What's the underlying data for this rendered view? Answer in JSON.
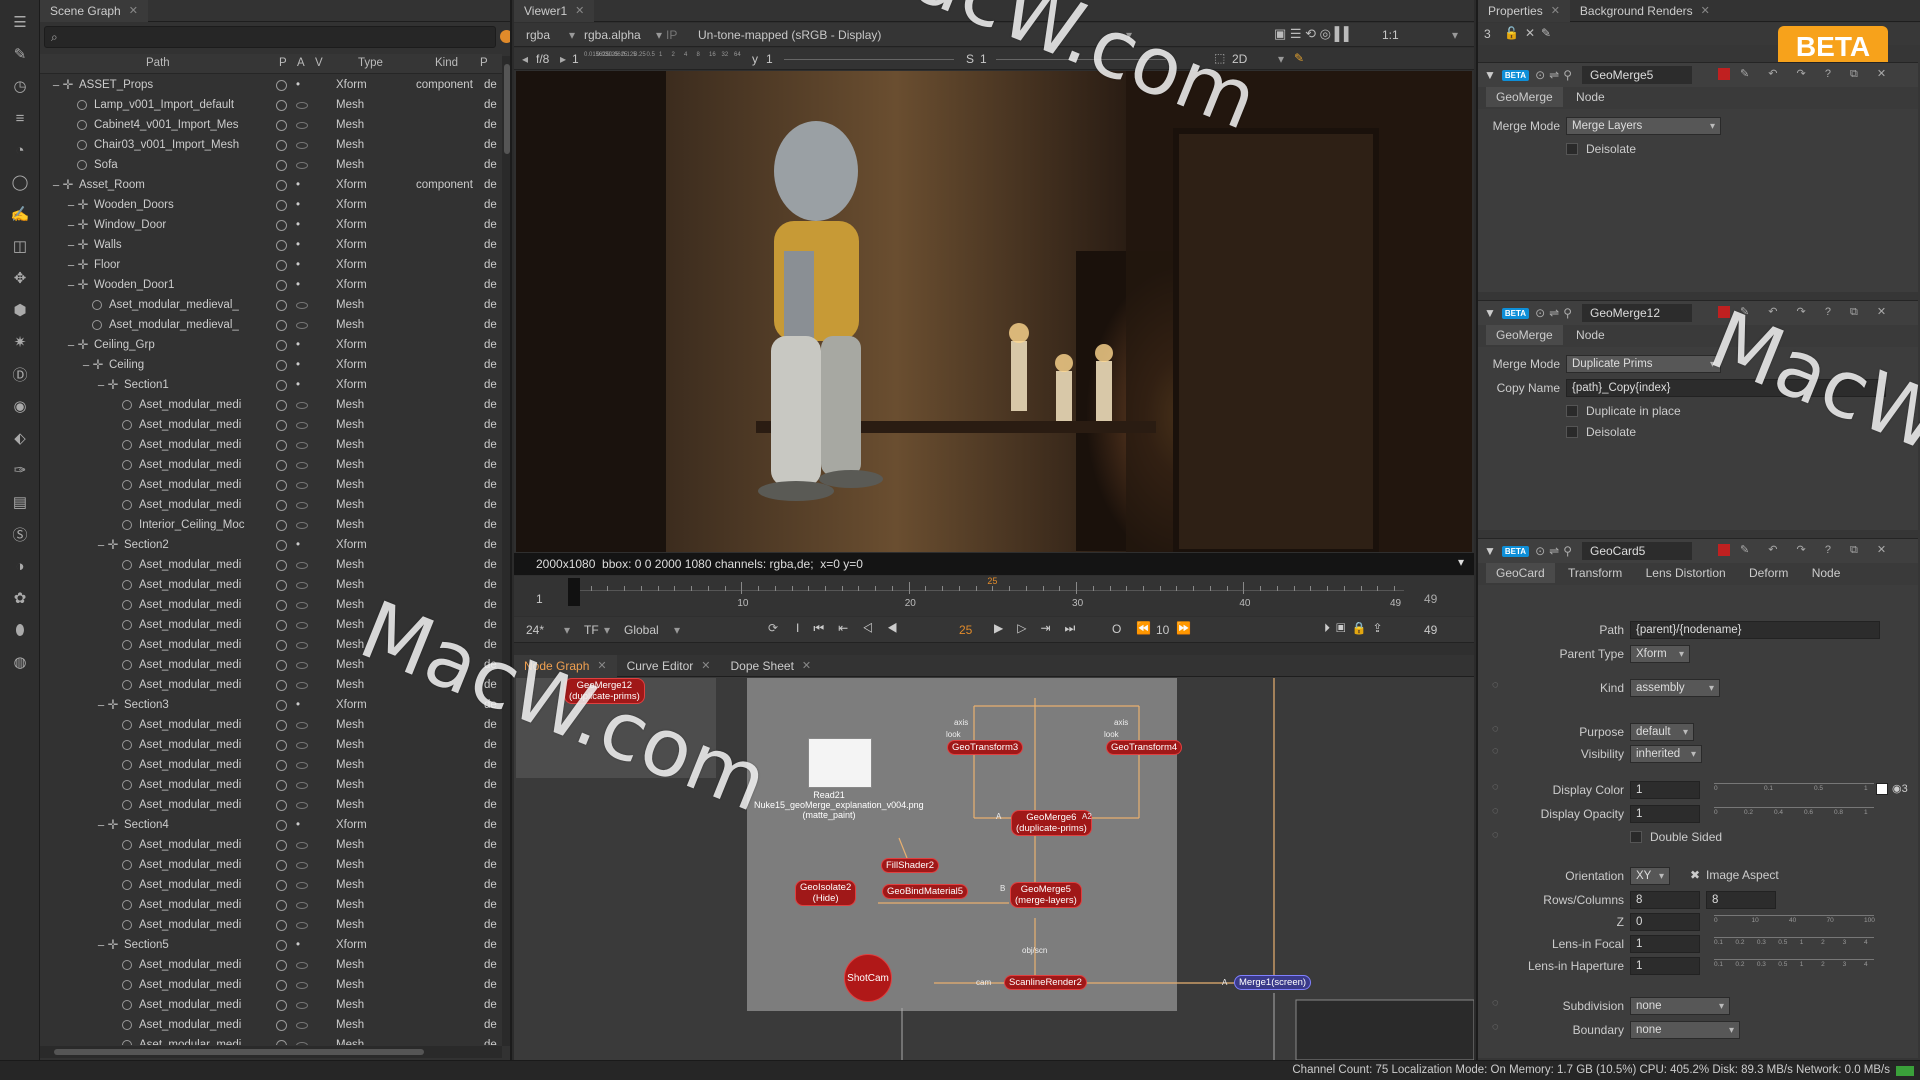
{
  "left_toolbar": {
    "icons": [
      "layers-icon",
      "pen-icon",
      "clock-icon",
      "list-icon",
      "pie-icon",
      "circle-icon",
      "paint-icon",
      "stack-icon",
      "move-icon",
      "cube-icon",
      "sparkle-icon",
      "d-icon",
      "eye-icon",
      "tag-icon",
      "brush-icon",
      "film-icon",
      "scene-icon",
      "wave-icon",
      "flower-icon",
      "cylinder-icon",
      "sphere-icon"
    ]
  },
  "scene_graph": {
    "tab": "Scene Graph",
    "headers": {
      "path": "Path",
      "p": "P",
      "a": "A",
      "v": "V",
      "type": "Type",
      "kind": "Kind",
      "p2": "P"
    },
    "rows": [
      {
        "indent": 1,
        "icon": "x",
        "name": "ASSET_Props",
        "type": "Xform",
        "kind": "component",
        "d": "de"
      },
      {
        "indent": 2,
        "icon": "m",
        "name": "Lamp_v001_Import_default",
        "type": "Mesh",
        "kind": "",
        "d": "de"
      },
      {
        "indent": 2,
        "icon": "m",
        "name": "Cabinet4_v001_Import_Mes",
        "type": "Mesh",
        "kind": "",
        "d": "de"
      },
      {
        "indent": 2,
        "icon": "m",
        "name": "Chair03_v001_Import_Mesh",
        "type": "Mesh",
        "kind": "",
        "d": "de"
      },
      {
        "indent": 2,
        "icon": "m",
        "name": "Sofa",
        "type": "Mesh",
        "kind": "",
        "d": "de"
      },
      {
        "indent": 1,
        "icon": "x",
        "name": "Asset_Room",
        "type": "Xform",
        "kind": "component",
        "d": "de"
      },
      {
        "indent": 2,
        "icon": "x",
        "name": "Wooden_Doors",
        "type": "Xform",
        "kind": "",
        "d": "de"
      },
      {
        "indent": 2,
        "icon": "x",
        "name": "Window_Door",
        "type": "Xform",
        "kind": "",
        "d": "de"
      },
      {
        "indent": 2,
        "icon": "x",
        "name": "Walls",
        "type": "Xform",
        "kind": "",
        "d": "de"
      },
      {
        "indent": 2,
        "icon": "x",
        "name": "Floor",
        "type": "Xform",
        "kind": "",
        "d": "de"
      },
      {
        "indent": 2,
        "icon": "x",
        "name": "Wooden_Door1",
        "type": "Xform",
        "kind": "",
        "d": "de"
      },
      {
        "indent": 3,
        "icon": "m",
        "name": "Aset_modular_medieval_",
        "type": "Mesh",
        "kind": "",
        "d": "de"
      },
      {
        "indent": 3,
        "icon": "m",
        "name": "Aset_modular_medieval_",
        "type": "Mesh",
        "kind": "",
        "d": "de"
      },
      {
        "indent": 2,
        "icon": "x",
        "name": "Ceiling_Grp",
        "type": "Xform",
        "kind": "",
        "d": "de"
      },
      {
        "indent": 3,
        "icon": "x",
        "name": "Ceiling",
        "type": "Xform",
        "kind": "",
        "d": "de"
      },
      {
        "indent": 4,
        "icon": "x",
        "name": "Section1",
        "type": "Xform",
        "kind": "",
        "d": "de"
      },
      {
        "indent": 5,
        "icon": "m",
        "name": "Aset_modular_medi",
        "type": "Mesh",
        "kind": "",
        "d": "de"
      },
      {
        "indent": 5,
        "icon": "m",
        "name": "Aset_modular_medi",
        "type": "Mesh",
        "kind": "",
        "d": "de"
      },
      {
        "indent": 5,
        "icon": "m",
        "name": "Aset_modular_medi",
        "type": "Mesh",
        "kind": "",
        "d": "de"
      },
      {
        "indent": 5,
        "icon": "m",
        "name": "Aset_modular_medi",
        "type": "Mesh",
        "kind": "",
        "d": "de"
      },
      {
        "indent": 5,
        "icon": "m",
        "name": "Aset_modular_medi",
        "type": "Mesh",
        "kind": "",
        "d": "de"
      },
      {
        "indent": 5,
        "icon": "m",
        "name": "Aset_modular_medi",
        "type": "Mesh",
        "kind": "",
        "d": "de"
      },
      {
        "indent": 5,
        "icon": "m",
        "name": "Interior_Ceiling_Moc",
        "type": "Mesh",
        "kind": "",
        "d": "de"
      },
      {
        "indent": 4,
        "icon": "x",
        "name": "Section2",
        "type": "Xform",
        "kind": "",
        "d": "de"
      },
      {
        "indent": 5,
        "icon": "m",
        "name": "Aset_modular_medi",
        "type": "Mesh",
        "kind": "",
        "d": "de"
      },
      {
        "indent": 5,
        "icon": "m",
        "name": "Aset_modular_medi",
        "type": "Mesh",
        "kind": "",
        "d": "de"
      },
      {
        "indent": 5,
        "icon": "m",
        "name": "Aset_modular_medi",
        "type": "Mesh",
        "kind": "",
        "d": "de"
      },
      {
        "indent": 5,
        "icon": "m",
        "name": "Aset_modular_medi",
        "type": "Mesh",
        "kind": "",
        "d": "de"
      },
      {
        "indent": 5,
        "icon": "m",
        "name": "Aset_modular_medi",
        "type": "Mesh",
        "kind": "",
        "d": "de"
      },
      {
        "indent": 5,
        "icon": "m",
        "name": "Aset_modular_medi",
        "type": "Mesh",
        "kind": "",
        "d": "de"
      },
      {
        "indent": 5,
        "icon": "m",
        "name": "Aset_modular_medi",
        "type": "Mesh",
        "kind": "",
        "d": "de"
      },
      {
        "indent": 4,
        "icon": "x",
        "name": "Section3",
        "type": "Xform",
        "kind": "",
        "d": "de"
      },
      {
        "indent": 5,
        "icon": "m",
        "name": "Aset_modular_medi",
        "type": "Mesh",
        "kind": "",
        "d": "de"
      },
      {
        "indent": 5,
        "icon": "m",
        "name": "Aset_modular_medi",
        "type": "Mesh",
        "kind": "",
        "d": "de"
      },
      {
        "indent": 5,
        "icon": "m",
        "name": "Aset_modular_medi",
        "type": "Mesh",
        "kind": "",
        "d": "de"
      },
      {
        "indent": 5,
        "icon": "m",
        "name": "Aset_modular_medi",
        "type": "Mesh",
        "kind": "",
        "d": "de"
      },
      {
        "indent": 5,
        "icon": "m",
        "name": "Aset_modular_medi",
        "type": "Mesh",
        "kind": "",
        "d": "de"
      },
      {
        "indent": 4,
        "icon": "x",
        "name": "Section4",
        "type": "Xform",
        "kind": "",
        "d": "de"
      },
      {
        "indent": 5,
        "icon": "m",
        "name": "Aset_modular_medi",
        "type": "Mesh",
        "kind": "",
        "d": "de"
      },
      {
        "indent": 5,
        "icon": "m",
        "name": "Aset_modular_medi",
        "type": "Mesh",
        "kind": "",
        "d": "de"
      },
      {
        "indent": 5,
        "icon": "m",
        "name": "Aset_modular_medi",
        "type": "Mesh",
        "kind": "",
        "d": "de"
      },
      {
        "indent": 5,
        "icon": "m",
        "name": "Aset_modular_medi",
        "type": "Mesh",
        "kind": "",
        "d": "de"
      },
      {
        "indent": 5,
        "icon": "m",
        "name": "Aset_modular_medi",
        "type": "Mesh",
        "kind": "",
        "d": "de"
      },
      {
        "indent": 4,
        "icon": "x",
        "name": "Section5",
        "type": "Xform",
        "kind": "",
        "d": "de"
      },
      {
        "indent": 5,
        "icon": "m",
        "name": "Aset_modular_medi",
        "type": "Mesh",
        "kind": "",
        "d": "de"
      },
      {
        "indent": 5,
        "icon": "m",
        "name": "Aset_modular_medi",
        "type": "Mesh",
        "kind": "",
        "d": "de"
      },
      {
        "indent": 5,
        "icon": "m",
        "name": "Aset_modular_medi",
        "type": "Mesh",
        "kind": "",
        "d": "de"
      },
      {
        "indent": 5,
        "icon": "m",
        "name": "Aset_modular_medi",
        "type": "Mesh",
        "kind": "",
        "d": "de"
      },
      {
        "indent": 5,
        "icon": "m",
        "name": "Aset_modular_medi",
        "type": "Mesh",
        "kind": "",
        "d": "de"
      }
    ]
  },
  "viewer": {
    "tab": "Viewer1",
    "channels": "rgba",
    "alpha": "rgba.alpha",
    "lut": "Un-tone-mapped (sRGB - Display)",
    "zoom": "1:1",
    "fstop": "f/8",
    "y_label": "y",
    "y_value": "1",
    "gain_value": "1",
    "s_label": "S",
    "s_value": "1",
    "mode": "2D",
    "ruler_ticks": [
      "0.015625",
      "0.03125",
      "0.0625",
      "0.125",
      "0.25",
      "0.5",
      "1",
      "2",
      "4",
      "8",
      "16",
      "32",
      "64"
    ],
    "info_bar": "2000x1080  bbox: 0 0 2000 1080 channels: rgba,de;  x=0 y=0",
    "timeline": {
      "start": "1",
      "end": "49",
      "ticks": [
        "0",
        "10",
        "20",
        "30",
        "40",
        "49"
      ],
      "current": "25",
      "fps": "24*",
      "tf": "TF",
      "scope": "Global",
      "frame": "25",
      "step": "10",
      "end_frame": "49"
    }
  },
  "node_graph": {
    "tabs": [
      "Node Graph",
      "Curve Editor",
      "Dope Sheet"
    ],
    "nodes": {
      "geomerge12": "GeoMerge12\n(duplicate-prims)",
      "geotransform3": "GeoTransform3",
      "geotransform4": "GeoTransform4",
      "geomerge6": "GeoMerge6\n(duplicate-prims)",
      "fillshader2": "FillShader2",
      "geoisolate2": "GeoIsolate2\n(Hide)",
      "geobindmaterial5": "GeoBindMaterial5",
      "geomerge5": "GeoMerge5\n(merge-layers)",
      "shotcam": "ShotCam",
      "scanlinerender2": "ScanlineRender2",
      "merge": "Merge1(screen)",
      "read21": "Read21\nNuke15_geoMerge_explanation_v004.png\n(matte_paint)"
    },
    "labels": {
      "look": "look",
      "axis": "axis",
      "a": "A",
      "b": "B",
      "a2": "A2",
      "cam": "cam",
      "obj_scn": "obj/scn"
    }
  },
  "properties": {
    "tabs": [
      "Properties",
      "Background Renders"
    ],
    "count": "3",
    "badge": "BETA",
    "panels": [
      {
        "name": "GeoMerge5",
        "tabs": [
          "GeoMerge",
          "Node"
        ],
        "merge_mode_label": "Merge Mode",
        "merge_mode": "Merge Layers",
        "deisolate": "Deisolate"
      },
      {
        "name": "GeoMerge12",
        "tabs": [
          "GeoMerge",
          "Node"
        ],
        "merge_mode_label": "Merge Mode",
        "merge_mode": "Duplicate Prims",
        "copy_name_label": "Copy Name",
        "copy_name": "{path}_Copy{index}",
        "dup_in_place": "Duplicate in place",
        "deisolate": "Deisolate"
      },
      {
        "name": "GeoCard5",
        "tabs": [
          "GeoCard",
          "Transform",
          "Lens Distortion",
          "Deform",
          "Node"
        ],
        "fields": {
          "path_label": "Path",
          "path": "{parent}/{nodename}",
          "parent_type_label": "Parent Type",
          "parent_type": "Xform",
          "kind_label": "Kind",
          "kind": "assembly",
          "purpose_label": "Purpose",
          "purpose": "default",
          "visibility_label": "Visibility",
          "visibility": "inherited",
          "display_color_label": "Display Color",
          "display_color": "1",
          "display_opacity_label": "Display Opacity",
          "display_opacity": "1",
          "double_sided": "Double Sided",
          "orientation_label": "Orientation",
          "orientation": "XY",
          "image_aspect": "Image Aspect",
          "rows_cols_label": "Rows/Columns",
          "rows": "8",
          "cols": "8",
          "z_label": "Z",
          "z": "0",
          "lens_focal_label": "Lens-in Focal",
          "lens_focal": "1",
          "lens_haperture_label": "Lens-in Haperture",
          "lens_haperture": "1",
          "subdivision_label": "Subdivision",
          "subdivision": "none",
          "boundary_label": "Boundary",
          "boundary": "none",
          "color_slider_ticks": [
            "0",
            "0.1",
            "0.5",
            "1"
          ],
          "opacity_slider_ticks": [
            "0",
            "0.2",
            "0.4",
            "0.6",
            "0.8",
            "1"
          ],
          "z_slider_ticks": [
            "0",
            "10",
            "40",
            "70",
            "100"
          ],
          "focal_slider_ticks": [
            "0.1",
            "0.2",
            "0.3",
            "0.5",
            "1",
            "2",
            "3",
            "4"
          ]
        }
      }
    ]
  },
  "status_bar": "Channel Count: 75  Localization Mode: On  Memory: 1.7 GB (10.5%)  CPU: 405.2%  Disk: 89.3 MB/s  Network: 0.0 MB/s",
  "watermarks": [
    "MacW.com",
    "MacW.com",
    "MacW.com"
  ]
}
